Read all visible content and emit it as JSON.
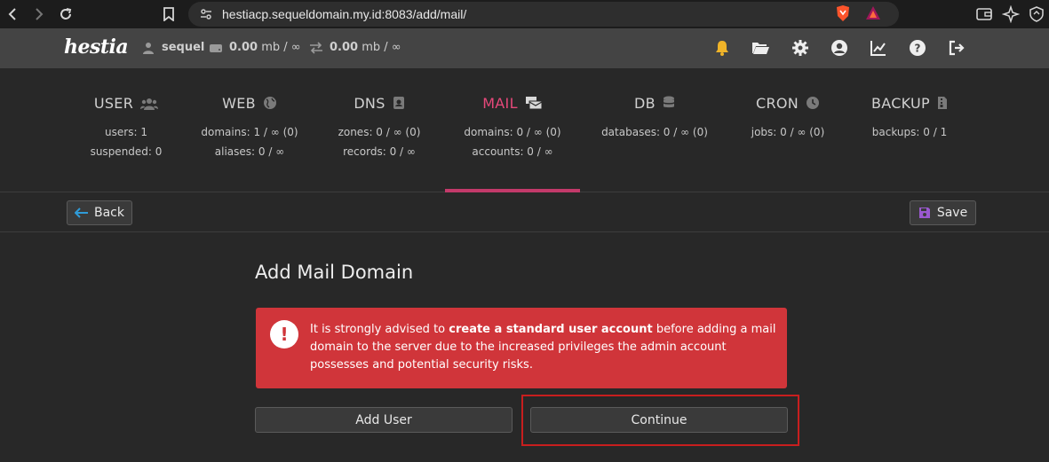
{
  "browser": {
    "url": "hestiacp.sequeldomain.my.id:8083/add/mail/"
  },
  "header": {
    "logo": "hestia",
    "username": "sequel",
    "disk_value": "0.00",
    "disk_limit": "mb / ∞",
    "bandwidth_value": "0.00",
    "bandwidth_limit": "mb / ∞"
  },
  "tabs": [
    {
      "title": "USER",
      "line1": "users: 1",
      "line2": "suspended: 0",
      "icon": "users-icon"
    },
    {
      "title": "WEB",
      "line1": "domains: 1 / ∞ (0)",
      "line2": "aliases: 0 / ∞",
      "icon": "globe-icon"
    },
    {
      "title": "DNS",
      "line1": "zones: 0 / ∞ (0)",
      "line2": "records: 0 / ∞",
      "icon": "address-book-icon"
    },
    {
      "title": "MAIL",
      "line1": "domains: 0 / ∞ (0)",
      "line2": "accounts: 0 / ∞",
      "icon": "mail-bulk-icon",
      "active": true
    },
    {
      "title": "DB",
      "line1": "databases: 0 / ∞ (0)",
      "line2": "",
      "icon": "database-icon"
    },
    {
      "title": "CRON",
      "line1": "jobs: 0 / ∞ (0)",
      "line2": "",
      "icon": "clock-icon"
    },
    {
      "title": "BACKUP",
      "line1": "backups: 0 / 1",
      "line2": "",
      "icon": "file-archive-icon"
    }
  ],
  "toolbar": {
    "back_label": "Back",
    "save_label": "Save"
  },
  "main": {
    "title": "Add Mail Domain",
    "alert_before": "It is strongly advised to ",
    "alert_bold": "create a standard user account",
    "alert_after": " before adding a mail domain to the server due to the increased privileges the admin account possesses and potential security risks.",
    "add_user_label": "Add User",
    "continue_label": "Continue"
  },
  "colors": {
    "accent": "#c33a6a",
    "active_tab": "#e6487a",
    "alert": "#d0353a",
    "highlight": "#c81e1e",
    "notification": "#f0b429"
  }
}
